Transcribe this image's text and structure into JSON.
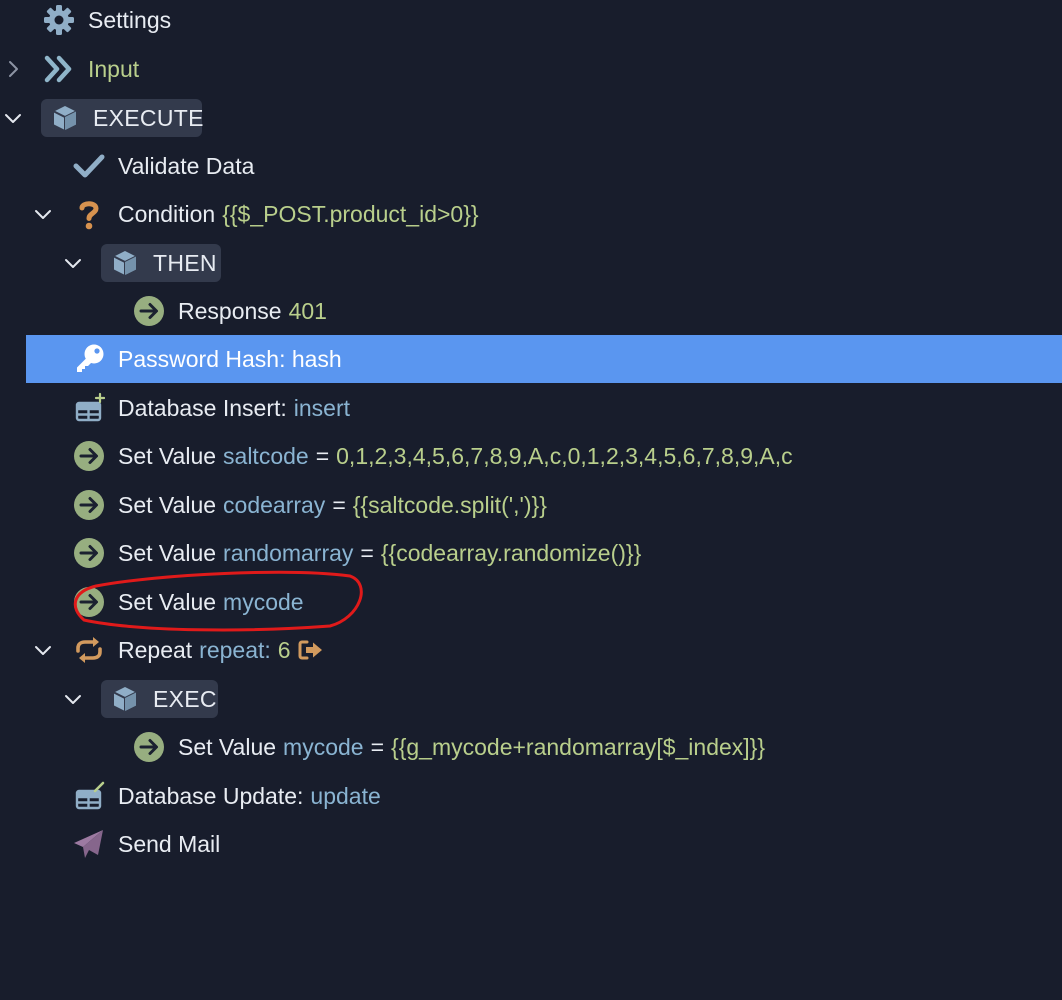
{
  "colors": {
    "background": "#181d2c",
    "selection": "#5a96f0",
    "label": "#e8ecf2",
    "variable": "#8ab4d2",
    "value": "#b9cf8c",
    "action_icon": "#97ae80",
    "repeat_icon": "#d29a5e",
    "question_icon": "#d7924f",
    "mail_icon": "#9d7aa2",
    "cube_icon": "#90aec7",
    "annotation": "#e01a1a"
  },
  "tree": {
    "settings": {
      "label": "Settings",
      "icon": "gear-icon"
    },
    "input": {
      "label": "Input",
      "icon": "double-chevron-icon"
    },
    "execute": {
      "label": "EXECUTE",
      "icon": "cube-icon"
    },
    "validate": {
      "label": "Validate Data",
      "icon": "checkmark-icon"
    },
    "condition": {
      "label": "Condition",
      "expression": "{{$_POST.product_id>0}}",
      "icon": "question-icon"
    },
    "then": {
      "label": "THEN",
      "icon": "cube-icon"
    },
    "response": {
      "label": "Response",
      "value": "401",
      "icon": "arrow-circle-icon"
    },
    "password_hash": {
      "label": "Password Hash: hash",
      "icon": "key-icon"
    },
    "db_insert": {
      "label": "Database Insert:",
      "name": "insert",
      "icon": "table-plus-icon"
    },
    "set_saltcode": {
      "label": "Set Value",
      "variable": "saltcode",
      "operator": "=",
      "value": "0,1,2,3,4,5,6,7,8,9,A,c,0,1,2,3,4,5,6,7,8,9,A,c",
      "icon": "arrow-circle-icon"
    },
    "set_codearray": {
      "label": "Set Value",
      "variable": "codearray",
      "operator": "=",
      "value": "{{saltcode.split(',')}}",
      "icon": "arrow-circle-icon"
    },
    "set_randomarray": {
      "label": "Set Value",
      "variable": "randomarray",
      "operator": "=",
      "value": "{{codearray.randomize()}}",
      "icon": "arrow-circle-icon"
    },
    "set_mycode": {
      "label": "Set Value",
      "variable": "mycode",
      "icon": "arrow-circle-icon"
    },
    "repeat": {
      "label": "Repeat",
      "name": "repeat:",
      "value": "6",
      "icon": "repeat-icon"
    },
    "exec": {
      "label": "EXEC",
      "icon": "cube-icon"
    },
    "set_mycode_inner": {
      "label": "Set Value",
      "variable": "mycode",
      "operator": "=",
      "value": "{{g_mycode+randomarray[$_index]}}",
      "icon": "arrow-circle-icon"
    },
    "db_update": {
      "label": "Database Update:",
      "name": "update",
      "icon": "table-edit-icon"
    },
    "send_mail": {
      "label": "Send Mail",
      "icon": "paper-plane-icon"
    }
  }
}
